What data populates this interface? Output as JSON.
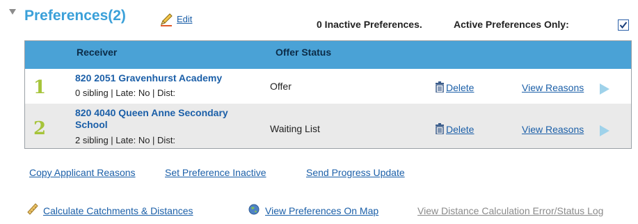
{
  "header": {
    "title": "Preferences",
    "count": "(2)",
    "edit_label": "Edit",
    "inactive_text": "0 Inactive Preferences.",
    "active_only_label": "Active Preferences Only:",
    "active_only_checked": true
  },
  "table": {
    "columns": [
      "Receiver",
      "Offer Status"
    ],
    "rows": [
      {
        "number": "1",
        "name_line1": "820 2051 Gravenhurst Academy",
        "name_line2": "",
        "meta": "0 sibling | Late: No | Dist:",
        "status": "Offer",
        "delete_label": "Delete",
        "view_label": "View Reasons"
      },
      {
        "number": "2",
        "name_line1": "820 4040 Queen Anne Secondary",
        "name_line2": "School",
        "meta": "2 sibling | Late: No | Dist:",
        "status": "Waiting List",
        "delete_label": "Delete",
        "view_label": "View Reasons"
      }
    ]
  },
  "actions": {
    "copy_reasons": "Copy Applicant Reasons",
    "set_inactive": "Set Preference Inactive",
    "send_progress": "Send Progress Update"
  },
  "bottom_links": {
    "calculate": "Calculate Catchments & Distances",
    "view_map": "View Preferences On Map",
    "view_errors": "View Distance Calculation Error/Status Log"
  },
  "colors": {
    "accent_title": "#3aa0d9",
    "table_header": "#4aa2d6",
    "link": "#1b5fa8",
    "row_number": "#a6c43a",
    "row_alt": "#eaeaea"
  },
  "icons": [
    "collapse-triangle-icon",
    "pencil-icon",
    "trash-icon",
    "play-arrow-icon",
    "ruler-icon",
    "globe-icon",
    "checkbox-check-icon"
  ]
}
